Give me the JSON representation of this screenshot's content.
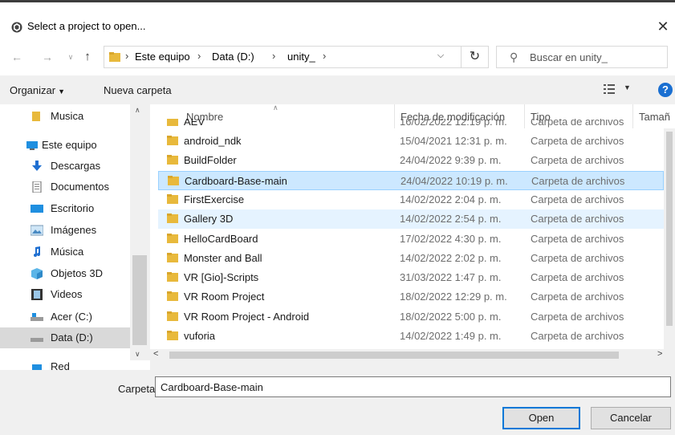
{
  "window": {
    "title": "Select a project to open...",
    "close_glyph": "✕"
  },
  "address": {
    "crumbs": [
      "Este equipo",
      "Data (D:)",
      "unity_"
    ],
    "search_placeholder": "Buscar en unity_"
  },
  "toolbar": {
    "organize_label": "Organizar",
    "new_folder_label": "Nueva carpeta",
    "help_glyph": "?"
  },
  "sidebar": {
    "items": [
      {
        "label": "Musica",
        "icon": "folder-icon"
      },
      {
        "label": "Este equipo",
        "icon": "computer-icon"
      },
      {
        "label": "Descargas",
        "icon": "downloads-icon"
      },
      {
        "label": "Documentos",
        "icon": "documents-icon"
      },
      {
        "label": "Escritorio",
        "icon": "desktop-icon"
      },
      {
        "label": "Imágenes",
        "icon": "pictures-icon"
      },
      {
        "label": "Música",
        "icon": "music-icon"
      },
      {
        "label": "Objetos 3D",
        "icon": "3d-objects-icon"
      },
      {
        "label": "Videos",
        "icon": "videos-icon"
      },
      {
        "label": "Acer (C:)",
        "icon": "drive-icon"
      },
      {
        "label": "Data (D:)",
        "icon": "drive-icon",
        "selected": true
      }
    ],
    "partial_item": {
      "label": "Red",
      "icon": "network-icon"
    }
  },
  "columns": {
    "name": "Nombre",
    "date": "Fecha de modificación",
    "type": "Tipo",
    "size": "Tamañ"
  },
  "files": {
    "partial_row": {
      "name": "AEV",
      "date": "16/02/2022 12:19 p. m.",
      "type": "Carpeta de archivos"
    },
    "rows": [
      {
        "name": "android_ndk",
        "date": "15/04/2021 12:31 p. m.",
        "type": "Carpeta de archivos"
      },
      {
        "name": "BuildFolder",
        "date": "24/04/2022 9:39 p. m.",
        "type": "Carpeta de archivos"
      },
      {
        "name": "Cardboard-Base-main",
        "date": "24/04/2022 10:19 p. m.",
        "type": "Carpeta de archivos",
        "state": "selected"
      },
      {
        "name": "FirstExercise",
        "date": "14/02/2022 2:04 p. m.",
        "type": "Carpeta de archivos"
      },
      {
        "name": "Gallery 3D",
        "date": "14/02/2022 2:54 p. m.",
        "type": "Carpeta de archivos",
        "state": "hover"
      },
      {
        "name": "HelloCardBoard",
        "date": "17/02/2022 4:30 p. m.",
        "type": "Carpeta de archivos"
      },
      {
        "name": "Monster and Ball",
        "date": "14/02/2022 2:02 p. m.",
        "type": "Carpeta de archivos"
      },
      {
        "name": "VR [Gio]-Scripts",
        "date": "31/03/2022 1:47 p. m.",
        "type": "Carpeta de archivos"
      },
      {
        "name": "VR Room Project",
        "date": "18/02/2022 12:29 p. m.",
        "type": "Carpeta de archivos"
      },
      {
        "name": "VR Room Project - Android",
        "date": "18/02/2022 5:00 p. m.",
        "type": "Carpeta de archivos"
      },
      {
        "name": "vuforia",
        "date": "14/02/2022 1:49 p. m.",
        "type": "Carpeta de archivos"
      }
    ]
  },
  "footer": {
    "folder_label": "Carpeta:",
    "folder_value": "Cardboard-Base-main",
    "open_label": "Open",
    "cancel_label": "Cancelar"
  },
  "colors": {
    "selection": "#cce8ff",
    "hover": "#e5f3ff",
    "folder": "#e8b93c",
    "accent": "#0078d7"
  }
}
